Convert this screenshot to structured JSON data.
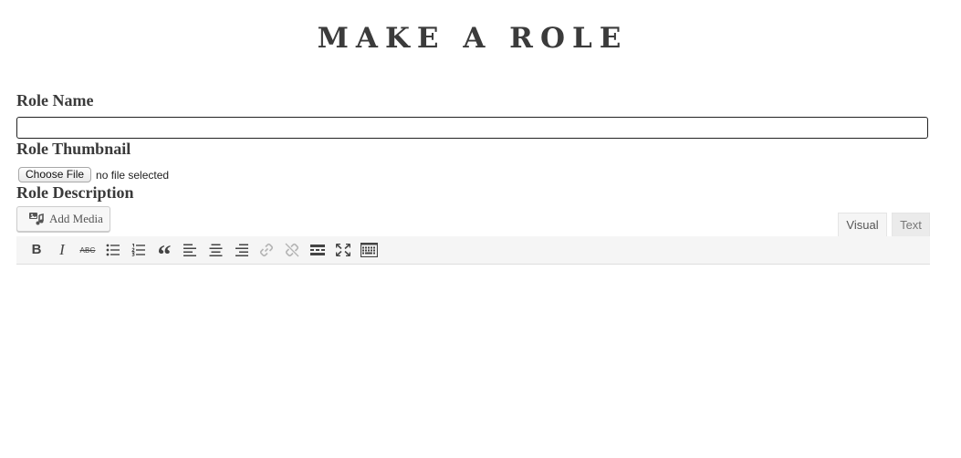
{
  "page": {
    "title": "MAKE A ROLE"
  },
  "form": {
    "role_name_label": "Role Name",
    "role_name_value": "",
    "role_thumbnail_label": "Role Thumbnail",
    "choose_file_label": "Choose File",
    "file_status": "no file selected",
    "role_description_label": "Role Description"
  },
  "editor": {
    "add_media_label": "Add Media",
    "tabs": [
      {
        "label": "Visual",
        "active": true
      },
      {
        "label": "Text",
        "active": false
      }
    ],
    "toolbar": [
      {
        "name": "bold",
        "icon": "bold-icon",
        "glyph": "B"
      },
      {
        "name": "italic",
        "icon": "italic-icon",
        "glyph": "I"
      },
      {
        "name": "strikethrough",
        "icon": "strikethrough-icon",
        "glyph": "ABC"
      },
      {
        "name": "bulleted-list",
        "icon": "bulleted-list-icon"
      },
      {
        "name": "numbered-list",
        "icon": "numbered-list-icon"
      },
      {
        "name": "blockquote",
        "icon": "blockquote-icon",
        "glyph": "“"
      },
      {
        "name": "align-left",
        "icon": "align-left-icon"
      },
      {
        "name": "align-center",
        "icon": "align-center-icon"
      },
      {
        "name": "align-right",
        "icon": "align-right-icon"
      },
      {
        "name": "insert-link",
        "icon": "link-icon",
        "disabled": true
      },
      {
        "name": "remove-link",
        "icon": "unlink-icon",
        "disabled": true
      },
      {
        "name": "read-more",
        "icon": "read-more-icon"
      },
      {
        "name": "fullscreen",
        "icon": "fullscreen-icon"
      },
      {
        "name": "toolbar-toggle",
        "icon": "keyboard-icon"
      }
    ],
    "content": ""
  },
  "colors": {
    "text": "#3a3a3a",
    "toolbar_bg": "#f5f5f5",
    "disabled_icon": "#b5b5b5"
  }
}
